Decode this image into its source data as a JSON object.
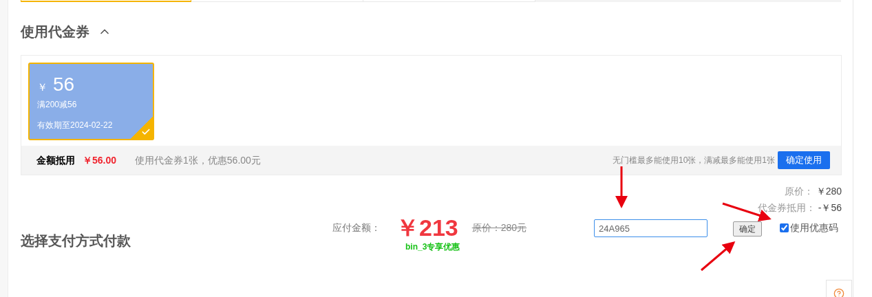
{
  "tabs": [
    {
      "selected": true
    },
    {
      "selected": false
    },
    {
      "selected": false
    }
  ],
  "voucher_section": {
    "title": "使用代金券",
    "expanded": true,
    "vouchers": [
      {
        "currency": "￥",
        "amount": "56",
        "rule": "满200减56",
        "validity": "有效期至2024-02-22",
        "selected": true
      }
    ],
    "summary": {
      "label": "金额抵用",
      "amount": "￥56.00",
      "note": "使用代金券1张，优惠56.00元",
      "limit_note": "无门槛最多能使用10张，满减最多能使用1张",
      "button": "确定使用"
    }
  },
  "price_breakdown": [
    {
      "label": "原价：",
      "value": "￥280"
    },
    {
      "label": "代金券抵用：",
      "value": "-￥56"
    }
  ],
  "payment": {
    "label": "应付金额：",
    "total": "￥213",
    "original": "原价：280元",
    "promo": "bin_3专享优惠"
  },
  "promo_code": {
    "value": "24A965",
    "button": "确定",
    "checkbox_label": "使用优惠码",
    "checked": true
  },
  "payment_method_title": "选择支付方式付款"
}
